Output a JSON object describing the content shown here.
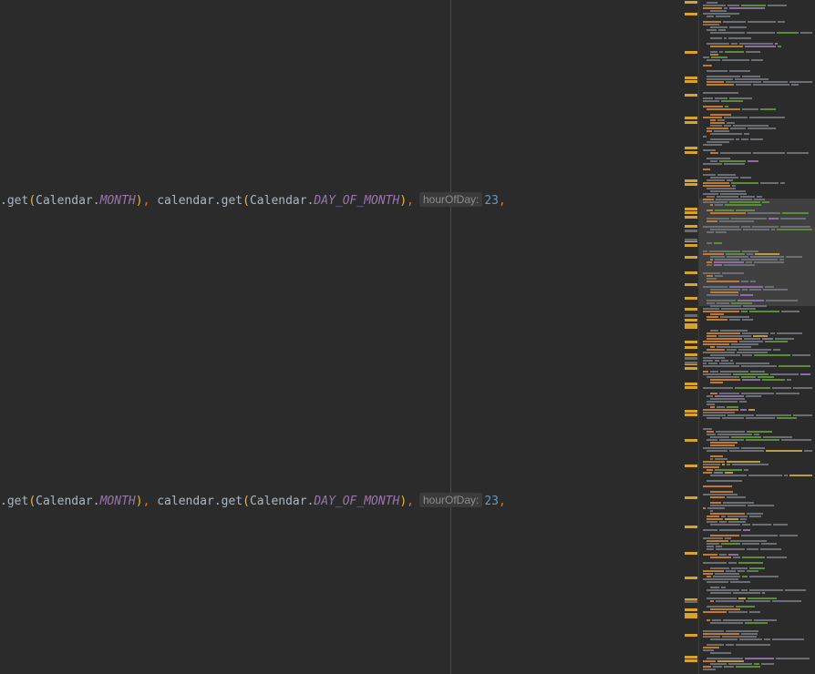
{
  "editor": {
    "lines": [
      {
        "prefix": ".get",
        "open1": "(",
        "class1": "Calendar",
        "dot1": ".",
        "const1": "MONTH",
        "close1": ")",
        "sep1": ", ",
        "call2": "calendar.get",
        "open2": "(",
        "class2": "Calendar",
        "dot2": ".",
        "const2": "DAY_OF_MONTH",
        "close2": ")",
        "sep2": ",",
        "hint": "hourOfDay:",
        "value": "23",
        "tail": ","
      },
      {
        "prefix": ".get",
        "open1": "(",
        "class1": "Calendar",
        "dot1": ".",
        "const1": "MONTH",
        "close1": ")",
        "sep1": ", ",
        "call2": "calendar.get",
        "open2": "(",
        "class2": "Calendar",
        "dot2": ".",
        "const2": "DAY_OF_MONTH",
        "close2": ")",
        "sep2": ",",
        "hint": "hourOfDay:",
        "value": "23",
        "tail": ","
      }
    ]
  },
  "colors": {
    "background": "#2b2b2b",
    "marker_warning": "#d7a42b",
    "constant": "#9876aa",
    "number": "#6897bb"
  }
}
